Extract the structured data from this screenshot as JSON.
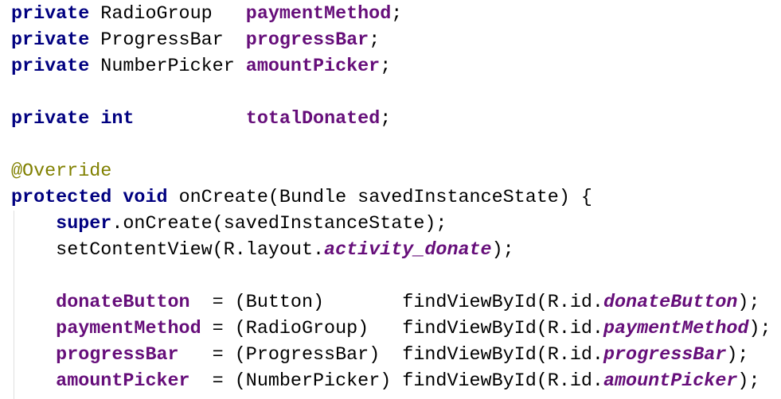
{
  "editor": {
    "lines": [
      {
        "kw": "private",
        "type": " RadioGroup   ",
        "field": "paymentMethod",
        "end": ";"
      },
      {
        "kw": "private",
        "type": " ProgressBar  ",
        "field": "progressBar",
        "end": ";"
      },
      {
        "kw": "private",
        "type": " NumberPicker ",
        "field": "amountPicker",
        "end": ";"
      },
      {
        "kw": "private",
        "kw2": "int",
        "pad": "          ",
        "field": "totalDonated",
        "end": ";"
      }
    ],
    "annotation": "@Override",
    "method_sig": {
      "kw": "protected",
      "kw2": "void",
      "rest": " onCreate(Bundle savedInstanceState) {"
    },
    "super_call": {
      "indent": "    ",
      "kw": "super",
      "rest": ".onCreate(savedInstanceState);"
    },
    "set_content": {
      "indent": "    ",
      "pre": "setContentView(R.layout.",
      "sfield": "activity_donate",
      "end": ");"
    },
    "assignments": [
      {
        "indent": "    ",
        "field": "donateButton ",
        "mid": " = (Button)       findViewById(R.id.",
        "sfield": "donateButton",
        "end": ");"
      },
      {
        "indent": "    ",
        "field": "paymentMethod",
        "mid": " = (RadioGroup)   findViewById(R.id.",
        "sfield": "paymentMethod",
        "end": ");"
      },
      {
        "indent": "    ",
        "field": "progressBar  ",
        "mid": " = (ProgressBar)  findViewById(R.id.",
        "sfield": "progressBar",
        "end": ");"
      },
      {
        "indent": "    ",
        "field": "amountPicker ",
        "mid": " = (NumberPicker) findViewById(R.id.",
        "sfield": "amountPicker",
        "end": ");"
      }
    ]
  },
  "colors": {
    "keyword": "#000080",
    "field": "#660e7a",
    "annotation": "#808000",
    "text": "#000000"
  }
}
